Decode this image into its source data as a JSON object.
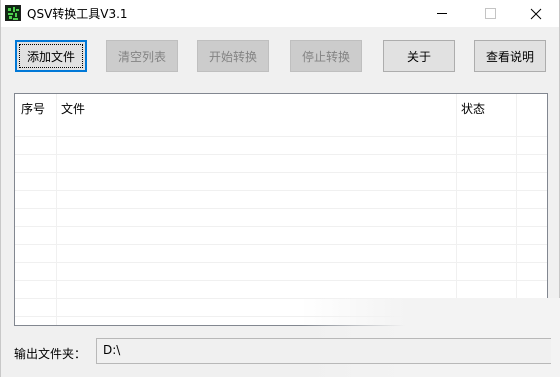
{
  "window": {
    "title": "QSV转换工具V3.1"
  },
  "toolbar": {
    "buttons": [
      {
        "label": "添加文件",
        "state": "focused"
      },
      {
        "label": "清空列表",
        "state": "disabled"
      },
      {
        "label": "开始转换",
        "state": "disabled"
      },
      {
        "label": "停止转换",
        "state": "disabled"
      },
      {
        "label": "关于",
        "state": "enabled"
      },
      {
        "label": "查看说明",
        "state": "enabled"
      }
    ]
  },
  "file_list": {
    "columns": [
      "序号",
      "文件",
      "状态"
    ],
    "rows": []
  },
  "output": {
    "label": "输出文件夹：",
    "value": "D:\\"
  },
  "colors": {
    "focus_border": "#0078d7",
    "disabled_text": "#838383",
    "icon_green": "#4fd14f"
  },
  "icons": {
    "app": "qsv-app-icon",
    "minimize": "minimize-icon",
    "maximize": "maximize-icon",
    "close": "close-icon"
  }
}
